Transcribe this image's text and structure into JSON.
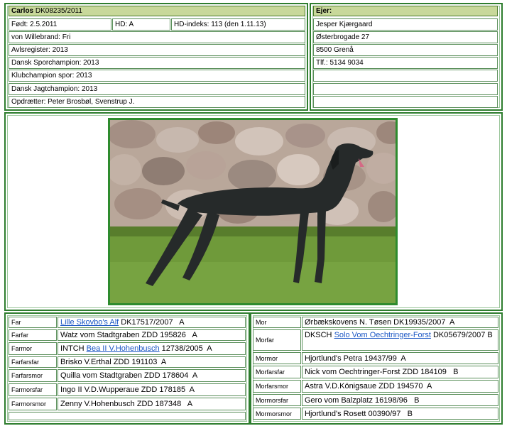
{
  "dog": {
    "name": "Carlos",
    "reg": "DK08235/2011",
    "born": "Født: 2.5.2011",
    "hd": "HD: A",
    "hd_index": "HD-indeks: 113 (den 1.11.13)",
    "kennel": "von Willebrand: Fri",
    "avl": "Avlsregister: 2013",
    "spor": "Dansk Sporchampion: 2013",
    "klub": "Klubchampion spor: 2013",
    "jagt": "Dansk Jagtchampion: 2013",
    "breeder": "Opdrætter: Peter Brosbøl, Svenstrup J."
  },
  "owner": {
    "title": "Ejer:",
    "name": "Jesper Kjærgaard",
    "street": "Østerbrogade 27",
    "city": "8500 Grenå",
    "phone": "Tlf.: 5134 9034"
  },
  "pedigree_left": [
    {
      "label": "Far",
      "link": "Lille Skovbo's Alf",
      "text": " DK17517/2007   A"
    },
    {
      "label": "Farfar",
      "text": "Watz vom Stadtgraben ZDD 195826   A"
    },
    {
      "label": "Farmor",
      "prefix": "INTCH ",
      "link": "Bea II V.Hohenbusch",
      "text": " 12738/2005  A"
    },
    {
      "label": "Farfarsfar",
      "text": "Brisko V.Erthal ZDD 191103  A"
    },
    {
      "label": "Farfarsmor",
      "text": "Quilla vom Stadtgraben ZDD 178604  A"
    },
    {
      "label": "Farmorsfar",
      "text": "Ingo II V.D.Wupperaue ZDD 178185  A"
    },
    {
      "label": "Farmorsmor",
      "text": "Zenny V.Hohenbusch ZDD 187348   A"
    }
  ],
  "pedigree_right": [
    {
      "label": "Mor",
      "text": "Ørbækskovens N. Tøsen DK19935/2007  A"
    },
    {
      "label": "Morfar",
      "prefix": "DKSCH ",
      "link": "Solo Vom Oechtringer-Forst",
      "text": " DK05679/2007 B"
    },
    {
      "label": "Mormor",
      "text": "Hjortlund's Petra 19437/99  A"
    },
    {
      "label": "Morfarsfar",
      "text": "Nick vom Oechtringer-Forst ZDD 184109   B"
    },
    {
      "label": "Morfarsmor",
      "text": "Astra V.D.Königsaue ZDD 194570  A"
    },
    {
      "label": "Mormorsfar",
      "text": "Gero vom Balzplatz 16198/96   B"
    },
    {
      "label": "Mormorsmor",
      "text": "Hjortlund's Rosett 00390/97   B"
    }
  ]
}
